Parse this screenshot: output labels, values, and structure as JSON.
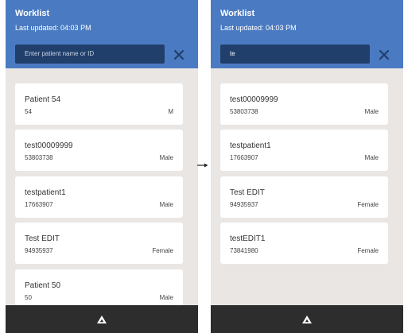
{
  "left": {
    "title": "Worklist",
    "updated": "Last updated: 04:03 PM",
    "search_placeholder": "Enter patient name or ID",
    "patients": [
      {
        "name": "Patient 54",
        "id": "54",
        "gender": "M"
      },
      {
        "name": "test00009999",
        "id": "53803738",
        "gender": "Male"
      },
      {
        "name": "testpatient1",
        "id": "17663907",
        "gender": "Male"
      },
      {
        "name": "Test EDIT",
        "id": "94935937",
        "gender": "Female"
      },
      {
        "name": "Patient 50",
        "id": "50",
        "gender": "Male"
      }
    ]
  },
  "right": {
    "title": "Worklist",
    "updated": "Last updated: 04:03 PM",
    "search_value": "te",
    "patients": [
      {
        "name": "test00009999",
        "id": "53803738",
        "gender": "Male"
      },
      {
        "name": "testpatient1",
        "id": "17663907",
        "gender": "Male"
      },
      {
        "name": "Test EDIT",
        "id": "94935937",
        "gender": "Female"
      },
      {
        "name": "testEDIT1",
        "id": "73841980",
        "gender": "Female"
      }
    ]
  },
  "icons": {
    "clear": "close-icon",
    "bottom": "triangle-logo-icon",
    "transition": "arrow-right-icon"
  }
}
